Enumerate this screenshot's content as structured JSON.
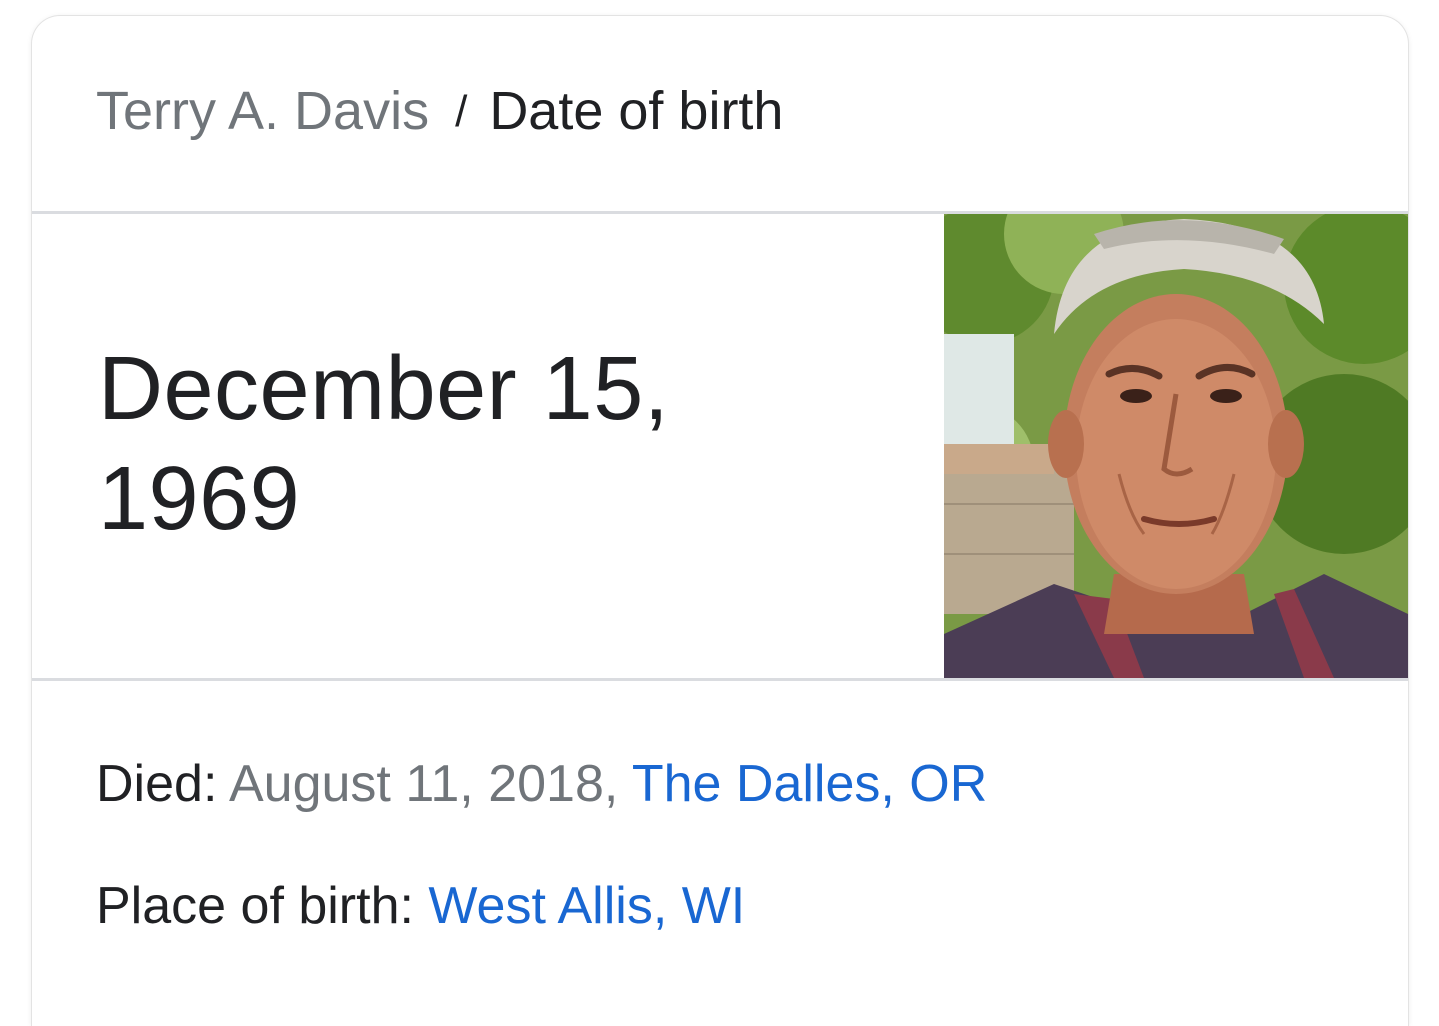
{
  "breadcrumb": {
    "parent": "Terry A. Davis",
    "separator": "/",
    "current": "Date of birth"
  },
  "answer": {
    "line1": "December 15,",
    "line2": "1969"
  },
  "facts": {
    "died": {
      "label": "Died: ",
      "date": "August 11, 2018, ",
      "place": "The Dalles, OR"
    },
    "place_of_birth": {
      "label": "Place of birth: ",
      "place": "West Allis, WI"
    }
  },
  "colors": {
    "link": "#1967d2",
    "muted_text": "#70757a",
    "primary_text": "#202124",
    "divider": "#dadce0"
  }
}
